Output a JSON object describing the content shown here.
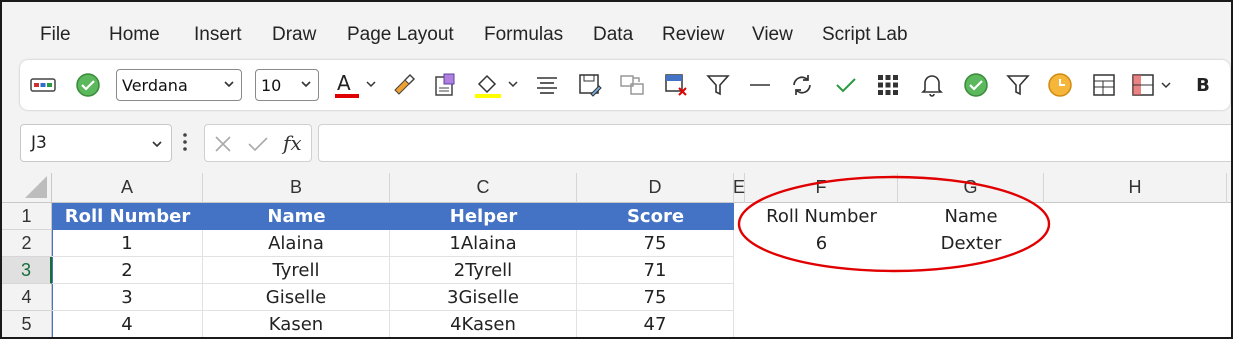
{
  "menu": [
    "File",
    "Home",
    "Insert",
    "Draw",
    "Page Layout",
    "Formulas",
    "Data",
    "Review",
    "View",
    "Script Lab"
  ],
  "toolbar": {
    "font_name": "Verdana",
    "font_size": "10",
    "bold_label": "B",
    "accent_font_color": "#e00000",
    "accent_highlight_color": "#ffff00"
  },
  "formula_bar": {
    "name_box": "J3",
    "fx_label": "fx",
    "formula": ""
  },
  "grid": {
    "columns": [
      "A",
      "B",
      "C",
      "D",
      "E",
      "F",
      "G",
      "H"
    ],
    "rows": [
      "1",
      "2",
      "3",
      "4",
      "5"
    ],
    "selected_row": "3",
    "table": {
      "headers": [
        "Roll Number",
        "Name",
        "Helper",
        "Score"
      ],
      "rows": [
        [
          "1",
          "Alaina",
          "1Alaina",
          "75"
        ],
        [
          "2",
          "Tyrell",
          "2Tyrell",
          "71"
        ],
        [
          "3",
          "Giselle",
          "3Giselle",
          "75"
        ],
        [
          "4",
          "Kasen",
          "4Kasen",
          "47"
        ]
      ]
    },
    "lookup": {
      "headers": [
        "Roll Number",
        "Name"
      ],
      "values": [
        "6",
        "Dexter"
      ]
    },
    "table_header_color": "#4472c4",
    "annotation_color": "#e00000"
  }
}
